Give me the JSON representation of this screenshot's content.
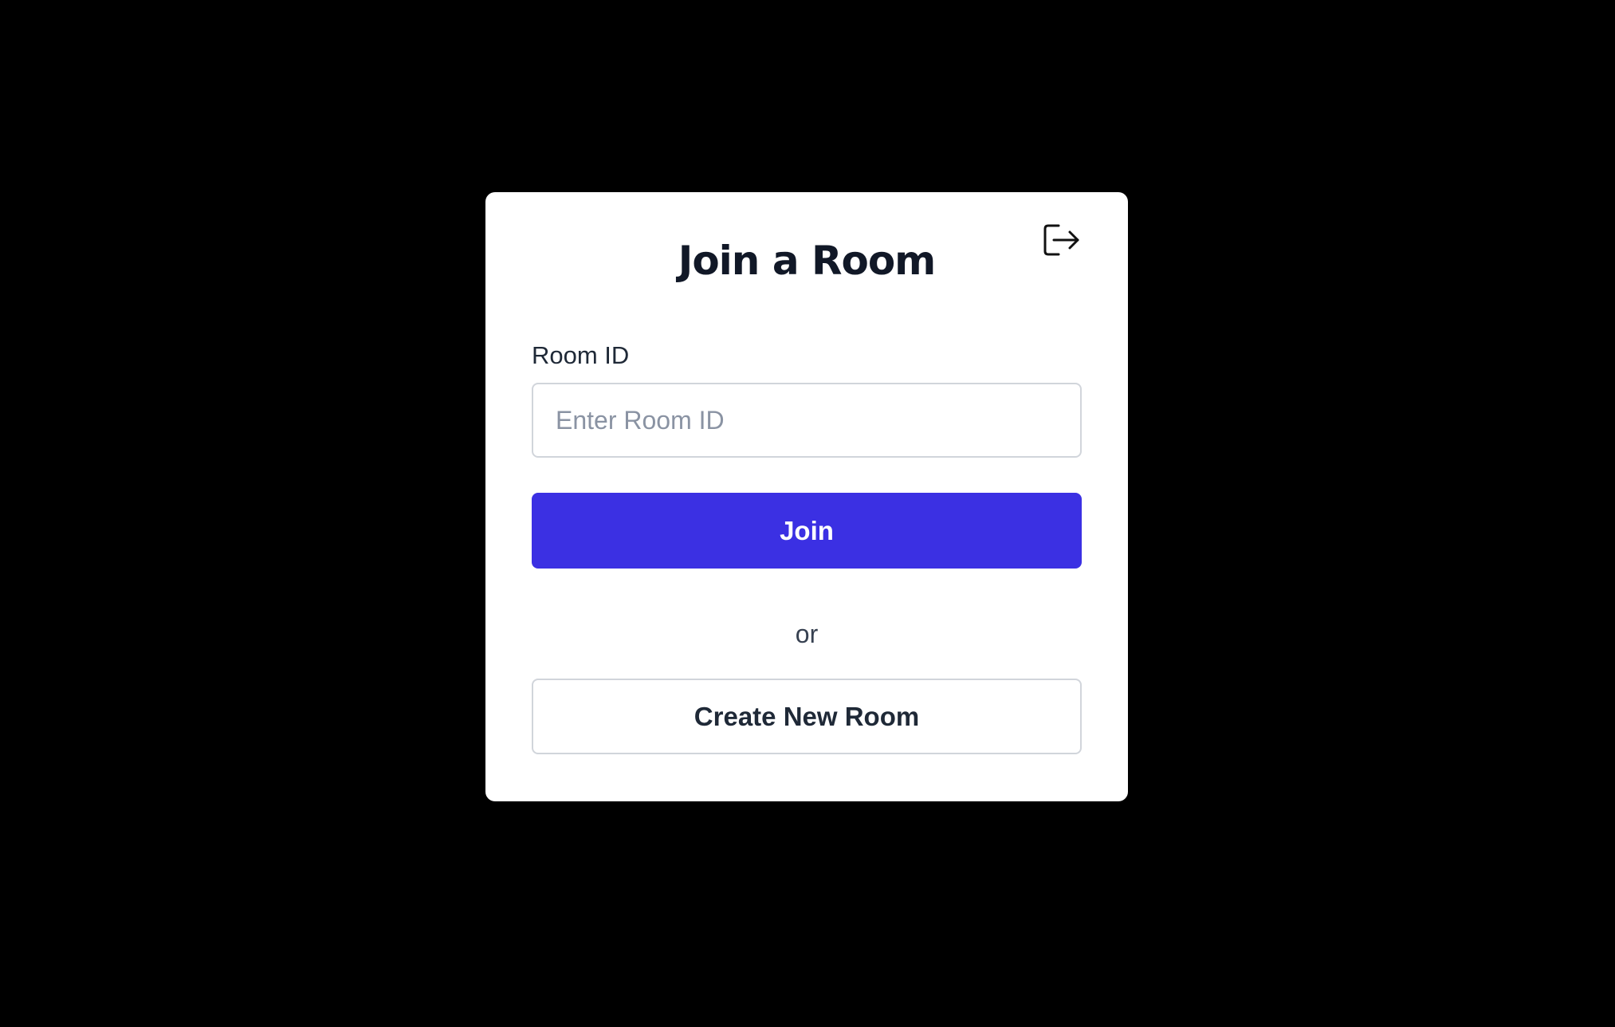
{
  "card": {
    "title": "Join a Room",
    "logout_icon": "logout-icon"
  },
  "form": {
    "room_id_label": "Room ID",
    "room_id_placeholder": "Enter Room ID",
    "room_id_value": "",
    "join_label": "Join",
    "divider_text": "or",
    "create_label": "Create New Room"
  },
  "colors": {
    "background": "#000000",
    "card": "#ffffff",
    "primary": "#3b30e3",
    "title": "#111827",
    "border": "#d1d5db",
    "placeholder": "#8a93a3"
  }
}
